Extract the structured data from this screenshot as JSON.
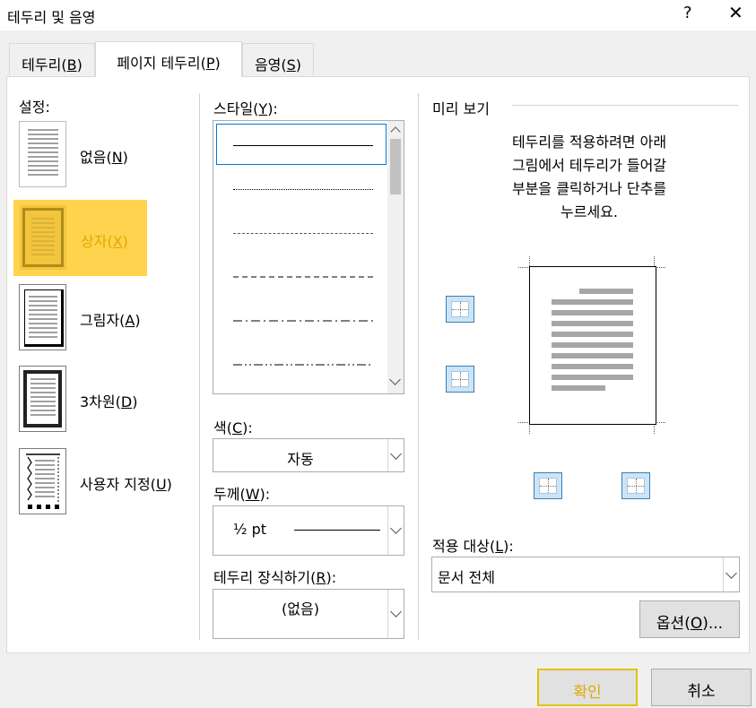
{
  "window": {
    "title": "테두리 및 음영",
    "help": "?",
    "close": "✕"
  },
  "tabs": [
    {
      "label": "테두리(B)",
      "text": "테두리(",
      "key": "B",
      "end": ")",
      "active": false
    },
    {
      "label": "페이지 테두리(P)",
      "text": "페이지 테두리(",
      "key": "P",
      "end": ")",
      "active": true
    },
    {
      "label": "음영(S)",
      "text": "음영(",
      "key": "S",
      "end": ")",
      "active": false
    }
  ],
  "settings": {
    "label": "설정:",
    "items": [
      {
        "text": "없음(",
        "key": "N",
        "end": ")",
        "selected": false
      },
      {
        "text": "상자(",
        "key": "X",
        "end": ")",
        "selected": true
      },
      {
        "text": "그림자(",
        "key": "A",
        "end": ")",
        "selected": false
      },
      {
        "text": "3차원(",
        "key": "D",
        "end": ")",
        "selected": false
      },
      {
        "text": "사용자 지정(",
        "key": "U",
        "end": ")",
        "selected": false
      }
    ]
  },
  "style": {
    "label": "스타일(",
    "key": "Y",
    "end": "):",
    "line_styles": [
      "solid",
      "dotted",
      "dashed-small",
      "dashed",
      "dash-dot",
      "dash-dot-dot"
    ],
    "selected_index": 0
  },
  "color": {
    "label": "색(",
    "key": "C",
    "end": "):",
    "value": "자동"
  },
  "width": {
    "label": "두께(",
    "key": "W",
    "end": "):",
    "value": "½ pt"
  },
  "art": {
    "label": "테두리 장식하기(",
    "key": "R",
    "end": "):",
    "value": "(없음)"
  },
  "preview": {
    "label": "미리 보기",
    "instruction": [
      "테두리를 적용하려면 아래",
      "그림에서 테두리가 들어갈",
      "부분을 클릭하거나 단추를",
      "누르세요."
    ]
  },
  "apply_to": {
    "label": "적용 대상(",
    "key": "L",
    "end": "):",
    "value": "문서 전체"
  },
  "options_button": {
    "text": "옵션(",
    "key": "O",
    "end": ")..."
  },
  "ok_button": "확인",
  "cancel_button": "취소",
  "colors": {
    "selection": "#ffd34d",
    "accent": "#0078d7",
    "ok_border": "#e6c200"
  }
}
